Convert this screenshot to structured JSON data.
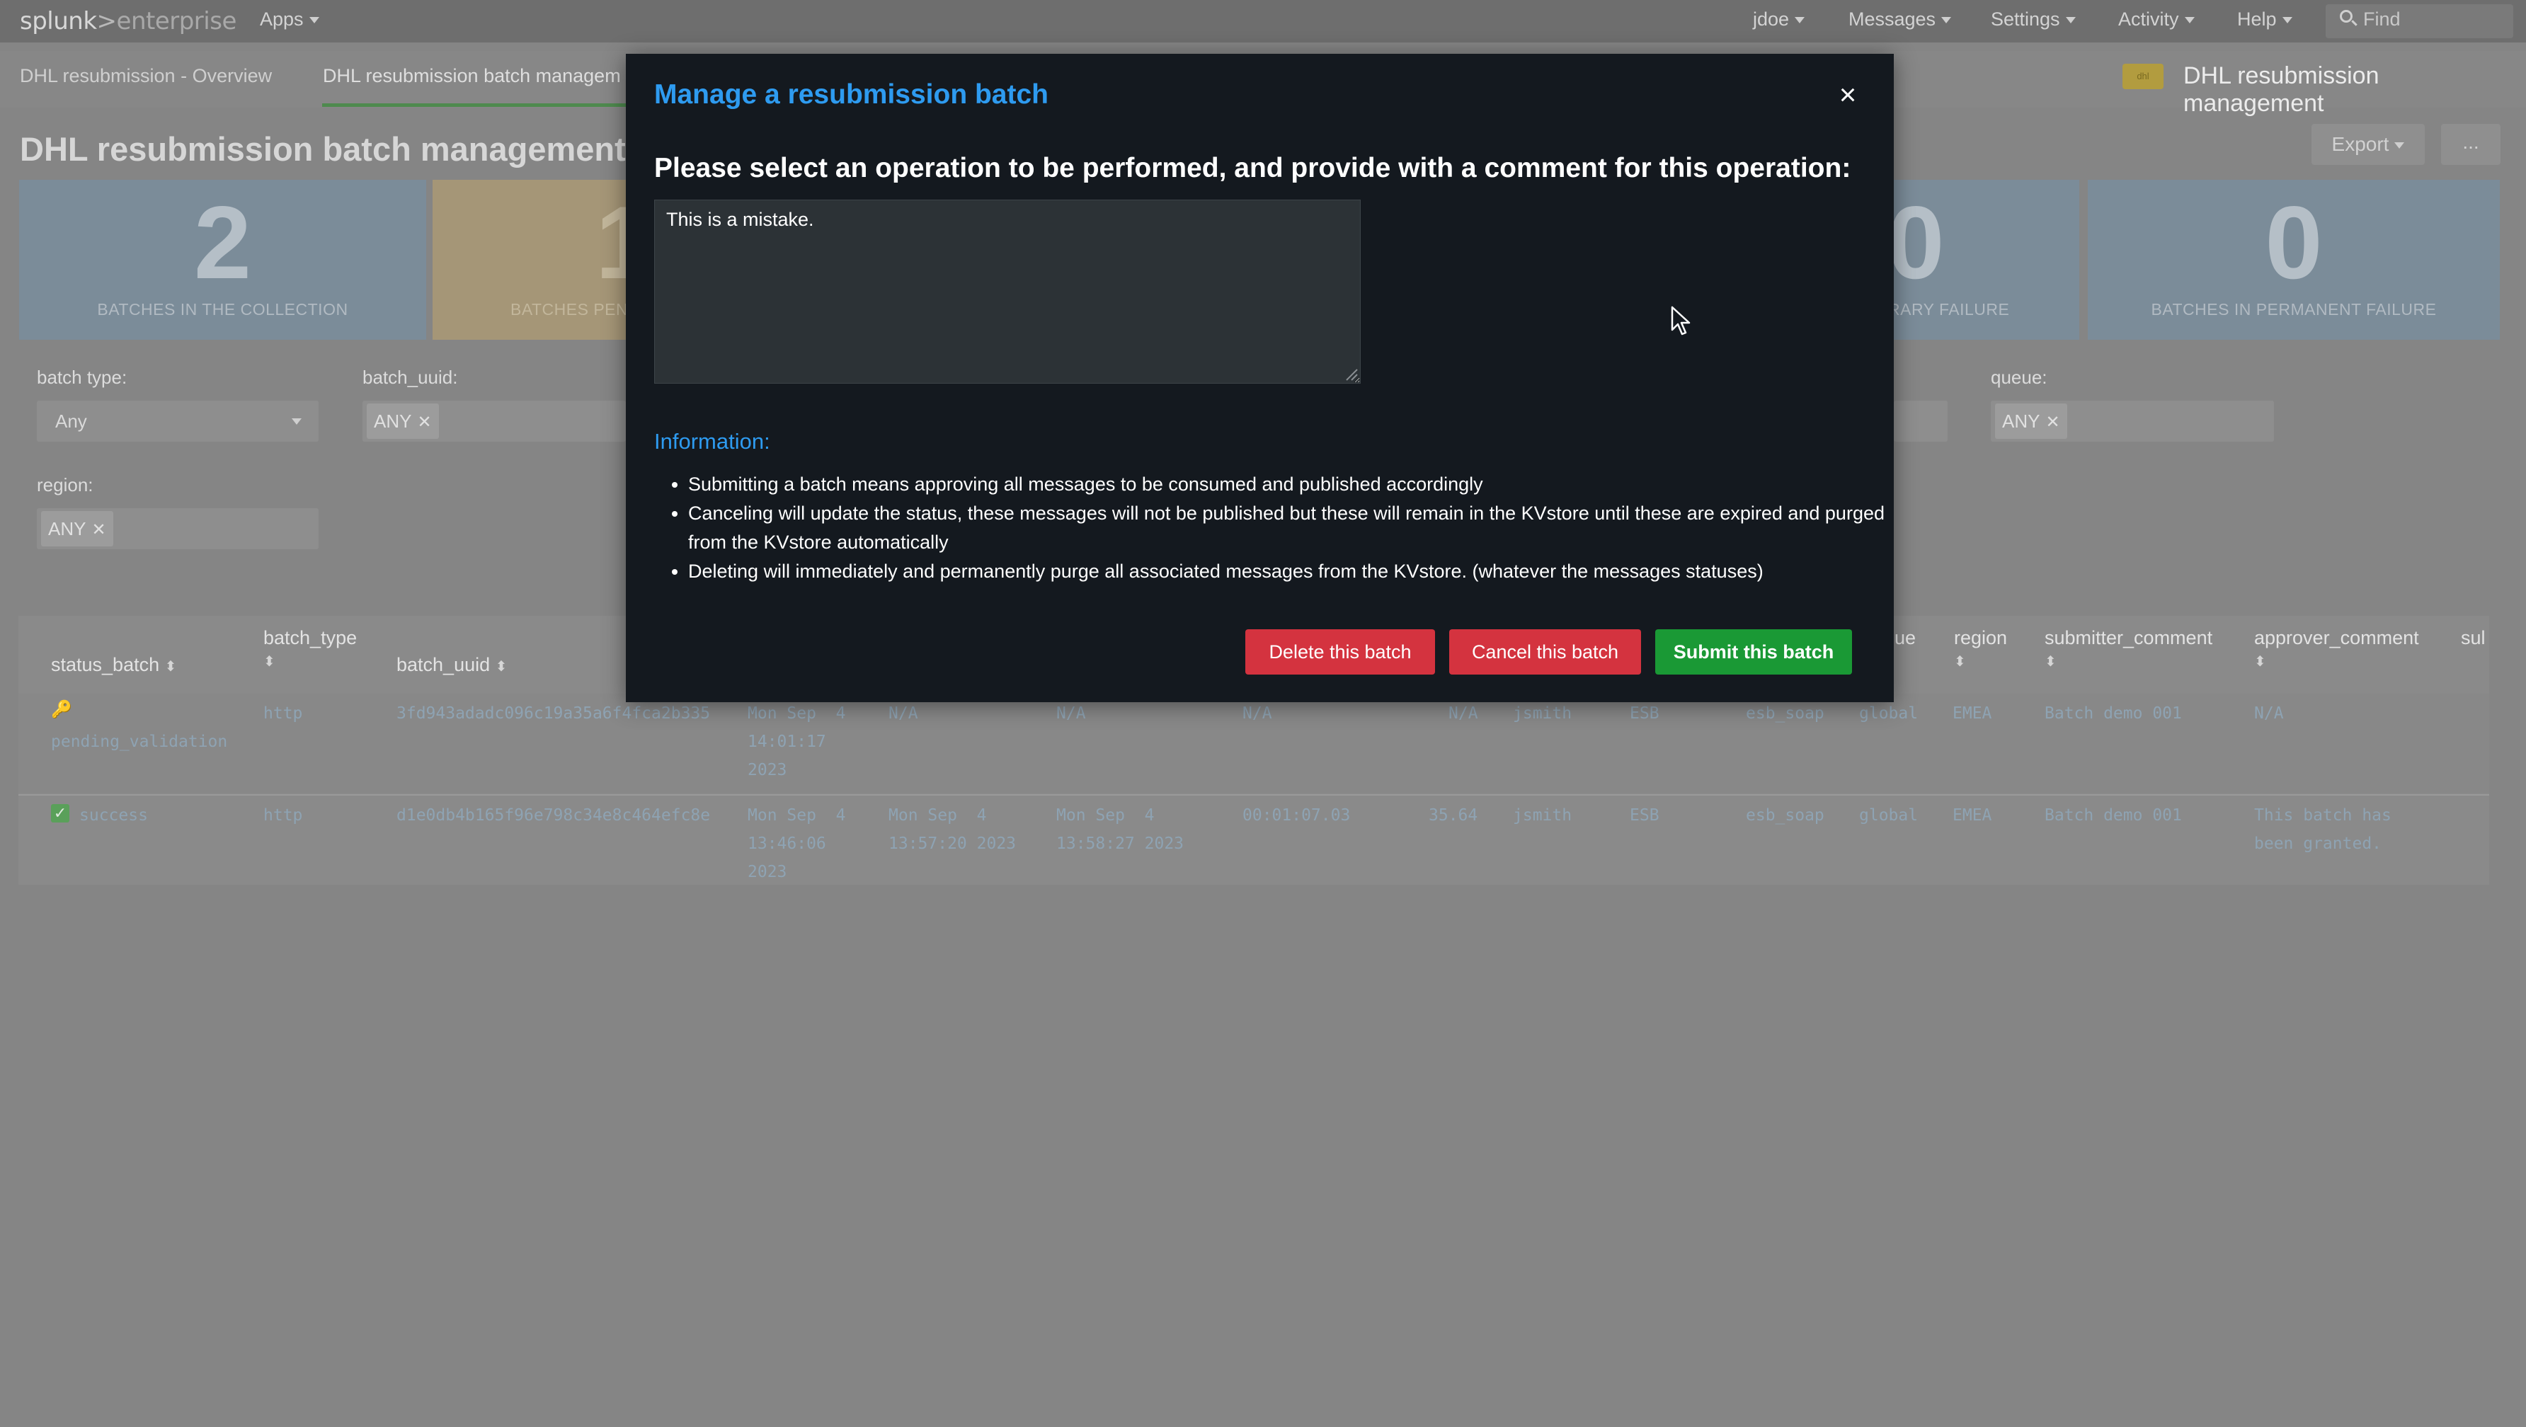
{
  "topbar": {
    "logo_main": "splunk",
    "logo_sep": ">",
    "logo_sub": "enterprise",
    "apps_label": "Apps",
    "user_label": "jdoe",
    "messages_label": "Messages",
    "settings_label": "Settings",
    "activity_label": "Activity",
    "help_label": "Help",
    "find_placeholder": "Find"
  },
  "nav": {
    "tabs": [
      {
        "label": "DHL resubmission - Overview"
      },
      {
        "label": "DHL resubmission batch managem"
      }
    ],
    "app_icon_text": "dhl",
    "app_name": "DHL resubmission management"
  },
  "page": {
    "title": "DHL resubmission batch management",
    "export_label": "Export",
    "more_label": "..."
  },
  "panels": [
    {
      "value": "2",
      "caption": "BATCHES IN THE COLLECTION"
    },
    {
      "value": "1",
      "caption": "BATCHES PEN"
    },
    {
      "value": "0",
      "caption": "RARY FAILURE"
    },
    {
      "value": "0",
      "caption": "BATCHES IN PERMANENT FAILURE"
    }
  ],
  "filters": {
    "batch_type": {
      "label": "batch type:",
      "value": "Any"
    },
    "batch_uuid": {
      "label": "batch_uuid:",
      "token": "ANY"
    },
    "queue": {
      "label": "queue:",
      "token": "ANY"
    },
    "region": {
      "label": "region:",
      "token": "ANY"
    }
  },
  "table": {
    "headers": {
      "status_batch": "status_batch",
      "batch_type": "batch_type",
      "batch_uuid": "batch_uuid",
      "queue": "ue",
      "region": "region",
      "submitter_comment": "submitter_comment",
      "approver_comment": "approver_comment",
      "last": "sul"
    },
    "rows": [
      {
        "status": "pending_validation",
        "batch_type": "http",
        "batch_uuid": "3fd943adadc096c19a35a6f4fca2b335",
        "c1": "Mon Sep  4",
        "c1b": "14:01:17",
        "c1c": "2023",
        "c2": "N/A",
        "c3": "N/A",
        "c4": "N/A",
        "c5": "N/A",
        "user": "jsmith",
        "system": "ESB",
        "app": "esb_soap",
        "scope": "global",
        "region": "EMEA",
        "submitter_comment": "Batch demo 001",
        "approver_comment": "N/A"
      },
      {
        "status": "success",
        "batch_type": "http",
        "batch_uuid": "d1e0db4b165f96e798c34e8c464efc8e",
        "c1": "Mon Sep  4",
        "c1b": "13:46:06",
        "c1c": "2023",
        "c2": "Mon Sep  4",
        "c2b": "13:57:20 2023",
        "c3": "Mon Sep  4",
        "c3b": "13:58:27 2023",
        "c4": "00:01:07.03",
        "c5": "35.64",
        "user": "jsmith",
        "system": "ESB",
        "app": "esb_soap",
        "scope": "global",
        "region": "EMEA",
        "submitter_comment": "Batch demo 001",
        "approver_comment": "This batch has",
        "approver_comment_2": "been granted."
      }
    ]
  },
  "modal": {
    "title": "Manage a resubmission batch",
    "close_label": "×",
    "heading": "Please select an operation to be performed, and provide with a comment for this operation:",
    "comment_value": "This is a mistake.",
    "info_title": "Information:",
    "info_items": [
      "Submitting a batch means approving all messages to be consumed and published accordingly",
      "Canceling will update the status, these messages will not be published but these will remain in the KVstore until these are expired and purged from the KVstore automatically",
      "Deleting will immediately and permanently purge all associated messages from the KVstore. (whatever the messages statuses)"
    ],
    "delete_label": "Delete this batch",
    "cancel_label": "Cancel this batch",
    "submit_label": "Submit this batch"
  },
  "colors": {
    "modal_bg": "#14191f",
    "title_blue": "#2e9bf0",
    "danger": "#d4333f",
    "success": "#1a9935"
  }
}
